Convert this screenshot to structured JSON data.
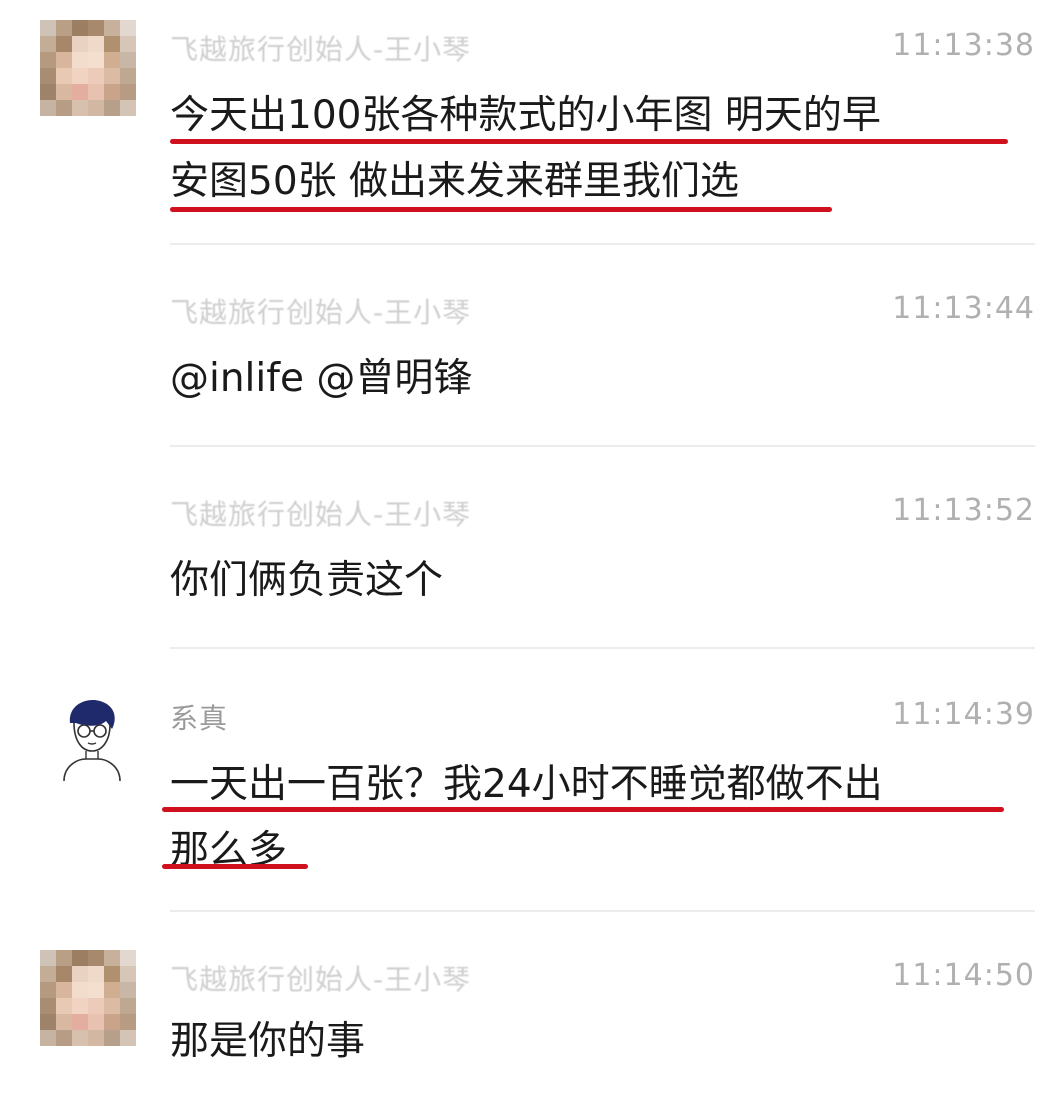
{
  "messages": [
    {
      "sender": "飞越旅行创始人-王小琴",
      "time": "11:13:38",
      "lines": [
        "今天出100张各种款式的小年图 明天的早",
        "安图50张 做出来发来群里我们选"
      ],
      "avatar": "blurred-photo-avatar",
      "highlighted": true
    },
    {
      "sender": "飞越旅行创始人-王小琴",
      "time": "11:13:44",
      "lines": [
        "@inlife @曾明锋"
      ],
      "avatar": "none",
      "highlighted": false
    },
    {
      "sender": "飞越旅行创始人-王小琴",
      "time": "11:13:52",
      "lines": [
        "你们俩负责这个"
      ],
      "avatar": "none",
      "highlighted": false
    },
    {
      "sender": "系真",
      "time": "11:14:39",
      "lines": [
        "一天出一百张？我24小时不睡觉都做不出",
        "那么多"
      ],
      "avatar": "sketch-boy-avatar",
      "highlighted": true
    },
    {
      "sender": "飞越旅行创始人-王小琴",
      "time": "11:14:50",
      "lines": [
        "那是你的事"
      ],
      "avatar": "blurred-photo-avatar",
      "highlighted": false
    }
  ],
  "colors": {
    "highlight_underline": "#d0101c",
    "message_text": "#1a1a1a",
    "timestamp": "#b0b0b0",
    "divider": "#ececec"
  }
}
